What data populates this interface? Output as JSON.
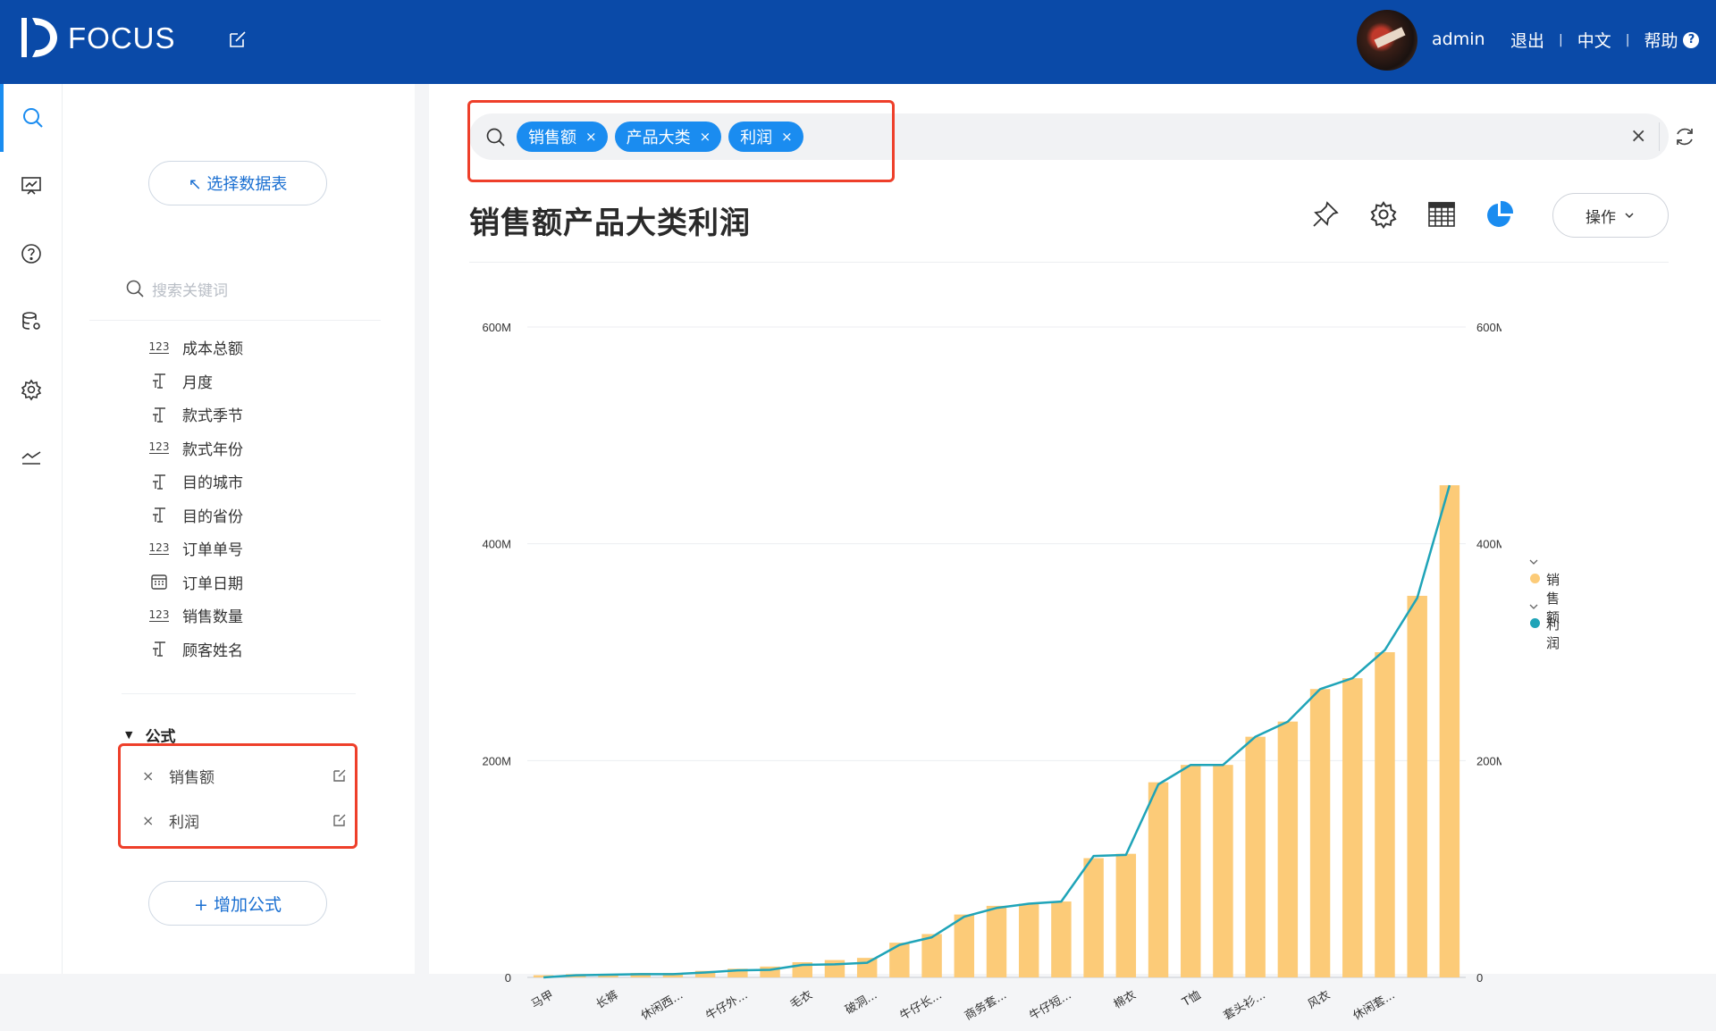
{
  "topbar": {
    "brand": "FOCUS",
    "user": "admin",
    "logout": "退出",
    "language": "中文",
    "help": "帮助",
    "help_icon": "?"
  },
  "sidebar": {
    "pick_table_label": "↖ 选择数据表",
    "search_placeholder": "搜索关键词",
    "columns": [
      {
        "type": "number",
        "icon_text": "123",
        "label": "成本总额"
      },
      {
        "type": "text",
        "icon_text": "T",
        "label": "月度"
      },
      {
        "type": "text",
        "icon_text": "T",
        "label": "款式季节"
      },
      {
        "type": "number",
        "icon_text": "123",
        "label": "款式年份"
      },
      {
        "type": "text",
        "icon_text": "T",
        "label": "目的城市"
      },
      {
        "type": "text",
        "icon_text": "T",
        "label": "目的省份"
      },
      {
        "type": "number",
        "icon_text": "123",
        "label": "订单单号"
      },
      {
        "type": "date",
        "icon_text": "",
        "label": "订单日期"
      },
      {
        "type": "number",
        "icon_text": "123",
        "label": "销售数量"
      },
      {
        "type": "text",
        "icon_text": "T",
        "label": "顾客姓名"
      }
    ],
    "formula_section": {
      "toggle": "▼",
      "title": "公式",
      "items": [
        {
          "remove": "×",
          "label": "销售额"
        },
        {
          "remove": "×",
          "label": "利润"
        }
      ]
    },
    "add_formula_label": "+ 增加公式"
  },
  "search": {
    "chips": [
      {
        "label": "销售额",
        "remove": "×"
      },
      {
        "label": "产品大类",
        "remove": "×"
      },
      {
        "label": "利润",
        "remove": "×"
      }
    ],
    "clear": "×"
  },
  "answer": {
    "title": "销售额产品大类利润",
    "operate_label": "操作",
    "operate_chevron": "⌄"
  },
  "chart_data": {
    "type": "bar",
    "combo": "bar + line",
    "categories": [
      "马甲",
      "",
      "长裤",
      "",
      "休闲西...",
      "",
      "牛仔外...",
      "",
      "毛衣",
      "",
      "破洞...",
      "",
      "牛仔长...",
      "",
      "商务套...",
      "",
      "牛仔短...",
      "",
      "棉衣",
      "",
      "T恤",
      "",
      "套头衫...",
      "",
      "风衣",
      "",
      "休闲套...",
      "",
      "",
      ""
    ],
    "series": [
      {
        "name": "销售额",
        "kind": "bar",
        "axis": "left",
        "color": "#fccb78",
        "values": [
          2,
          3,
          3,
          4,
          4,
          6,
          8,
          10,
          14,
          16,
          18,
          32,
          40,
          58,
          66,
          68,
          70,
          110,
          114,
          180,
          196,
          196,
          222,
          236,
          266,
          276,
          300,
          352,
          454
        ]
      },
      {
        "name": "利润",
        "kind": "line",
        "axis": "right",
        "color": "#1fa4b8",
        "values": [
          0,
          2,
          2.5,
          3,
          3,
          4.5,
          6.5,
          7,
          11.5,
          12,
          13.5,
          30,
          37,
          56,
          64,
          68,
          70,
          112,
          113,
          178,
          196,
          196,
          222,
          236,
          266,
          276,
          302,
          350,
          454
        ]
      }
    ],
    "y_left": {
      "min": 0,
      "max": 600,
      "ticks": [
        0,
        200,
        400,
        600
      ],
      "tick_labels": [
        "0",
        "200M",
        "400M",
        "600M"
      ]
    },
    "y_right": {
      "min": 0,
      "max": 600,
      "ticks": [
        0,
        200,
        400,
        600
      ],
      "tick_labels": [
        "0",
        "200M",
        "400M",
        "600M"
      ]
    },
    "legend": {
      "position": "right",
      "items": [
        "销售额",
        "利润"
      ],
      "chevron": "⌄"
    },
    "grid": true
  },
  "colors": {
    "topbar": "#0a4aa8",
    "accent": "#1a8cf0",
    "highlight_box": "#ee3f2a",
    "bar": "#fccb78",
    "line": "#1fa4b8"
  }
}
